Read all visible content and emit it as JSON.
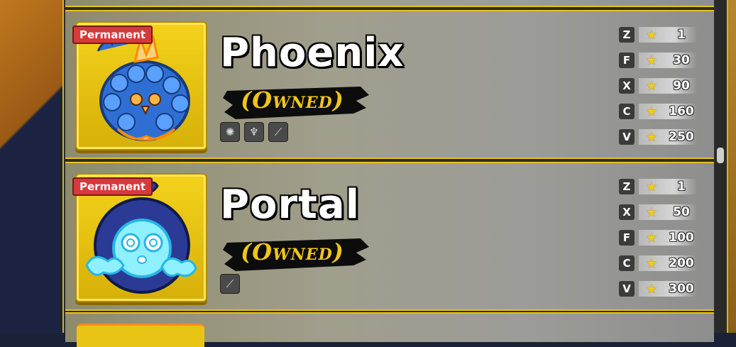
{
  "fruits": [
    {
      "badge": "Permanent",
      "name": "Phoenix",
      "status": "(Owned)",
      "abilities": [
        "gear-icon",
        "ember-icon",
        "slash-icon"
      ],
      "moves": [
        {
          "key": "Z",
          "level": "1"
        },
        {
          "key": "F",
          "level": "30"
        },
        {
          "key": "X",
          "level": "90"
        },
        {
          "key": "C",
          "level": "160"
        },
        {
          "key": "V",
          "level": "250"
        }
      ]
    },
    {
      "badge": "Permanent",
      "name": "Portal",
      "status": "(Owned)",
      "abilities": [
        "slash-icon"
      ],
      "moves": [
        {
          "key": "Z",
          "level": "1"
        },
        {
          "key": "X",
          "level": "50"
        },
        {
          "key": "F",
          "level": "100"
        },
        {
          "key": "C",
          "level": "200"
        },
        {
          "key": "V",
          "level": "300"
        }
      ]
    }
  ],
  "colors": {
    "accent": "#e5c21f",
    "badge": "#d63a3a",
    "owned": "#f0c51a",
    "star": "#f1cc1a"
  }
}
